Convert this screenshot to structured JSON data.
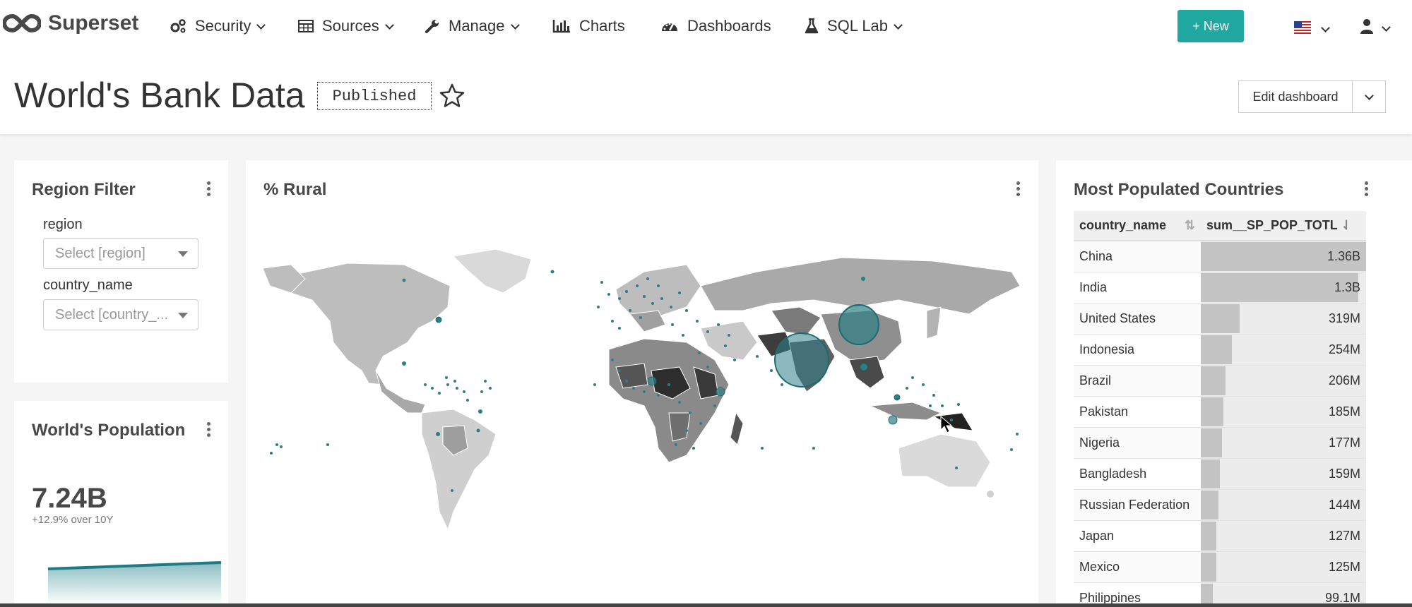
{
  "nav": {
    "logo_text": "Superset",
    "items": [
      {
        "label": "Security",
        "icon": "gears-icon",
        "dropdown": true
      },
      {
        "label": "Sources",
        "icon": "table-icon",
        "dropdown": true
      },
      {
        "label": "Manage",
        "icon": "wrench-icon",
        "dropdown": true
      },
      {
        "label": "Charts",
        "icon": "bar-chart-icon",
        "dropdown": false
      },
      {
        "label": "Dashboards",
        "icon": "dashboard-icon",
        "dropdown": false
      },
      {
        "label": "SQL Lab",
        "icon": "flask-icon",
        "dropdown": true
      }
    ],
    "new_button": "+ New",
    "language_icon": "us-flag-icon",
    "user_icon": "user-icon"
  },
  "dashboard": {
    "title": "World's Bank Data",
    "status_badge": "Published",
    "edit_button": "Edit dashboard"
  },
  "region_filter": {
    "title": "Region Filter",
    "filters": [
      {
        "label": "region",
        "placeholder": "Select [region]"
      },
      {
        "label": "country_name",
        "placeholder": "Select [country_..."
      }
    ]
  },
  "world_population": {
    "title": "World's Population",
    "value": "7.24B",
    "subtext": "+12.9% over 10Y"
  },
  "rural_map": {
    "title": "% Rural"
  },
  "most_populated": {
    "title": "Most Populated Countries",
    "columns": [
      "country_name",
      "sum__SP_POP_TOTL"
    ],
    "rows": [
      {
        "country": "China",
        "value": "1.36B",
        "ratio": 1.0
      },
      {
        "country": "India",
        "value": "1.3B",
        "ratio": 0.955
      },
      {
        "country": "United States",
        "value": "319M",
        "ratio": 0.234
      },
      {
        "country": "Indonesia",
        "value": "254M",
        "ratio": 0.187
      },
      {
        "country": "Brazil",
        "value": "206M",
        "ratio": 0.151
      },
      {
        "country": "Pakistan",
        "value": "185M",
        "ratio": 0.136
      },
      {
        "country": "Nigeria",
        "value": "177M",
        "ratio": 0.13
      },
      {
        "country": "Bangladesh",
        "value": "159M",
        "ratio": 0.117
      },
      {
        "country": "Russian Federation",
        "value": "144M",
        "ratio": 0.106
      },
      {
        "country": "Japan",
        "value": "127M",
        "ratio": 0.093
      },
      {
        "country": "Mexico",
        "value": "125M",
        "ratio": 0.092
      },
      {
        "country": "Philippines",
        "value": "99.1M",
        "ratio": 0.073
      }
    ]
  },
  "colors": {
    "accent": "#20a7a0",
    "bubble": "#2d7f86"
  }
}
